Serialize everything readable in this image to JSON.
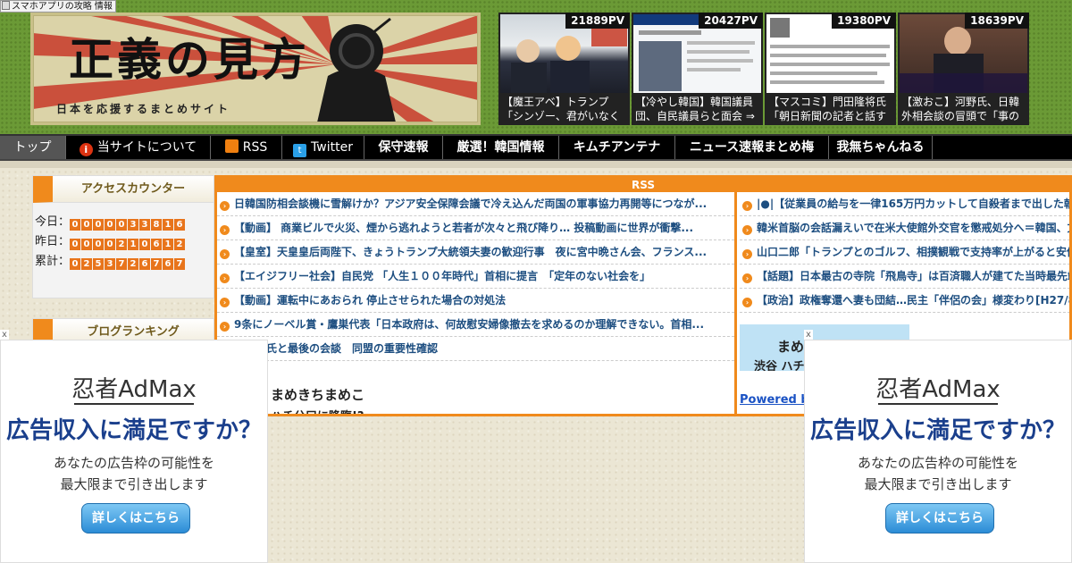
{
  "top_note": "スマホアプリの攻略 情報",
  "banner": {
    "title": "正義の見方",
    "subtitle": "日本を応援するまとめサイト"
  },
  "thumbnails": [
    {
      "pv": "21889PV",
      "caption": "【魔王アベ】トランプ「シンゾー、君がいなく"
    },
    {
      "pv": "20427PV",
      "caption": "【冷やし韓国】韓国議員団、自民議員らと面会 ⇒"
    },
    {
      "pv": "19380PV",
      "caption": "【マスコミ】門田隆将氏「朝日新聞の記者と話す"
    },
    {
      "pv": "18639PV",
      "caption": "【激おこ】河野氏、日韓外相会談の冒頭で「事の"
    }
  ],
  "nav": [
    {
      "label": "トップ",
      "icon": null
    },
    {
      "label": "当サイトについて",
      "icon": "info-icon"
    },
    {
      "label": "RSS",
      "icon": "rss-icon"
    },
    {
      "label": "Twitter",
      "icon": "twitter-icon"
    },
    {
      "label": "保守速報",
      "icon": null
    },
    {
      "label": "厳選！韓国情報",
      "icon": null
    },
    {
      "label": "キムチアンテナ",
      "icon": null
    },
    {
      "label": "ニュース速報まとめ梅",
      "icon": null
    },
    {
      "label": "我無ちゃんねる",
      "icon": null
    }
  ],
  "counter": {
    "title": "アクセスカウンター",
    "today_label": "今日：",
    "today": "0000033816",
    "yesterday_label": "昨日：",
    "yesterday": "0000210612",
    "total_label": "累計：",
    "total": "0253726767"
  },
  "ranking": {
    "title": "ブログランキング"
  },
  "rss": {
    "header": "RSS",
    "left_items": [
      "日韓国防相会談機に雪解けか？アジア安全保障会議で冷え込んだ両国の軍事協力再開等につなが...",
      "【動画】 商業ビルで火災、煙から逃れようと若者が次々と飛び降り… 投稿動画に世界が衝撃...",
      "【皇室】天皇皇后両陛下、きょうトランプ大統領夫妻の歓迎行事　夜に宮中晩さん会、フランス...",
      "【エイジフリー社会】自民党 「人生１００年時代」首相に提言　「定年のない社会を」",
      "【動画】運転中にあおられ 停止させられた場合の対処法",
      "9条にノーベル賞・鷹巣代表「日本政府は、何故慰安婦像撤去を求めるのか理解できない。首相...",
      "オバマ氏と最後の会談　同盟の重要性確認"
    ],
    "right_items": [
      "|●|【従業員の給与を一律165万円カットして自殺者まで出した朝日",
      "韓米首脳の会話漏えいで在米大使館外交官を懲戒処分へ＝韓国、文",
      "山口二郎「トランプとのゴルフ、相撲観戦で支持率が上がると安倍",
      "【話題】日本最古の寺院「飛鳥寺」は百済職人が建てた当時最先端",
      "【政治】政権奪還へ妻も団結…民主「伴侶の会」様変わり[H27/8/2"
    ],
    "mamechi_left_top": "まめきちまめこ",
    "mamechi_left_bottom": "ハチ公口に降臨!?",
    "mamechi_right_top": "まめきちまめこ",
    "mamechi_right_bottom": "渋谷 ハチ公口",
    "powered_by": "Powered by"
  },
  "ads": [
    {
      "close": "x",
      "brand": "忍者AdMax",
      "headline": "広告収入に満足ですか？",
      "sub1": "あなたの広告枠の可能性を",
      "sub2": "最大限まで引き出します",
      "button": "詳しくはこちら"
    },
    {
      "close": "x",
      "brand": "忍者AdMax",
      "headline": "広告収入に満足ですか？",
      "sub1": "あなたの広告枠の可能性を",
      "sub2": "最大限まで引き出します",
      "button": "詳しくはこちら"
    }
  ],
  "colors": {
    "header_green": "#6b9a36",
    "accent_orange": "#f08a1c",
    "link_blue": "#1d4e80"
  }
}
